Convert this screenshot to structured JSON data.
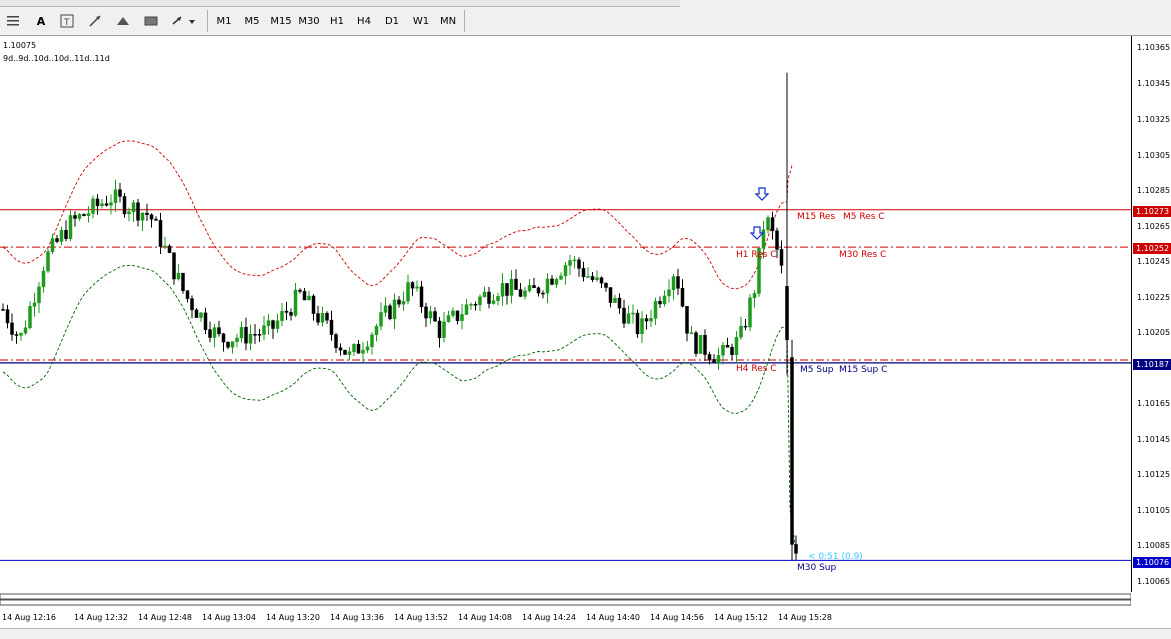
{
  "toolbar": {
    "timeframes": [
      "M1",
      "M5",
      "M15",
      "M30",
      "H1",
      "H4",
      "D1",
      "W1",
      "MN"
    ]
  },
  "chart": {
    "top_price": "1.10075",
    "period_info": "9d..9d..10d..10d..11d..11d",
    "price_axis": [
      "1.10365",
      "1.10345",
      "1.10325",
      "1.10305",
      "1.10285",
      "1.10265",
      "1.10245",
      "1.10225",
      "1.10205",
      "1.10185",
      "1.10165",
      "1.10145",
      "1.10125",
      "1.10105",
      "1.10085",
      "1.10065"
    ],
    "price_tags": {
      "r1": {
        "value": "1.10273",
        "color": "#cc0000"
      },
      "r2": {
        "value": "1.10252",
        "color": "#cc0000"
      },
      "s1": {
        "value": "1.10187",
        "color": "#000080"
      },
      "s2": {
        "value": "1.10076",
        "color": "#0000cc"
      }
    },
    "level_labels": {
      "m15_res": "M15 Res",
      "m5_res_c": "M5 Res C",
      "h1_res_c": "H1 Res C",
      "m30_res_c": "M30 Res C",
      "h4_res_c": "H4 Res C",
      "m5_sup": "M5 Sup",
      "m15_sup_c": "M15 Sup C",
      "m30_sup": "M30 Sup",
      "countdown": "< 0:51 (0.9)"
    },
    "time_axis": [
      "14 Aug 12:16",
      "14 Aug 12:32",
      "14 Aug 12:48",
      "14 Aug 13:04",
      "14 Aug 13:20",
      "14 Aug 13:36",
      "14 Aug 13:52",
      "14 Aug 14:08",
      "14 Aug 14:24",
      "14 Aug 14:40",
      "14 Aug 14:56",
      "14 Aug 15:12",
      "14 Aug 15:28"
    ]
  },
  "colors": {
    "bull": "#1f9a1f",
    "resistance": "#cc0000",
    "support": "#000080",
    "envelope_upper": "#cc0000",
    "envelope_lower": "#006400",
    "countdown": "#33ccff"
  }
}
